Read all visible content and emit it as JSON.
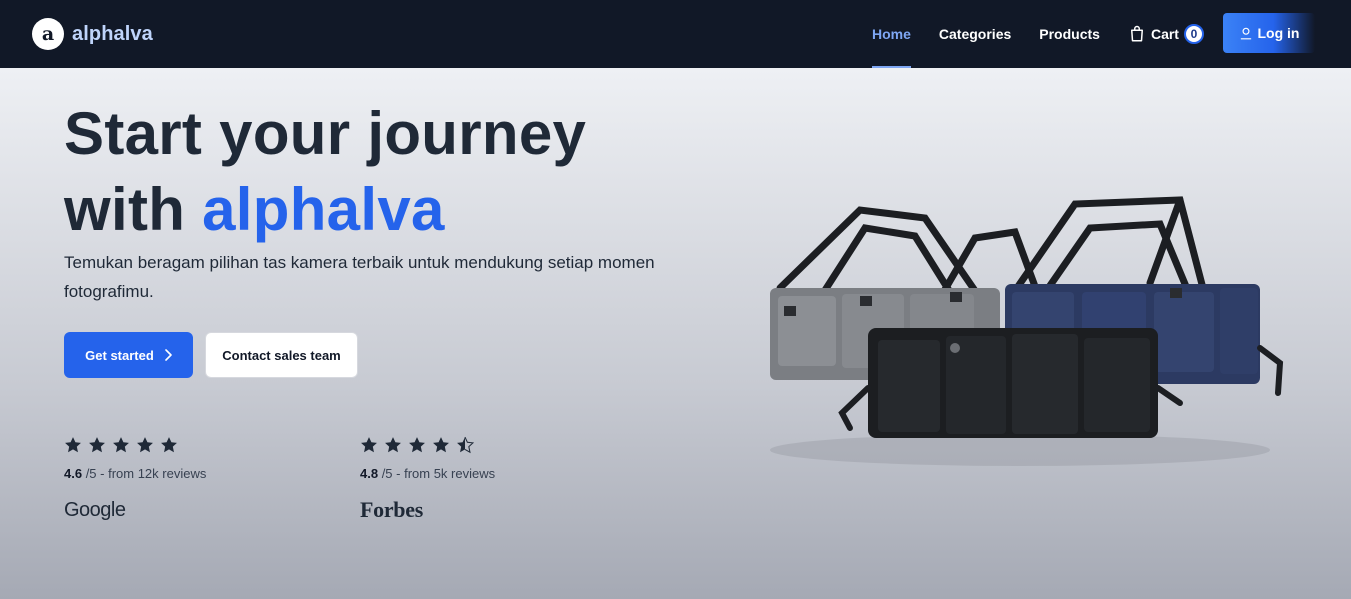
{
  "brand": {
    "logo_glyph": "a",
    "name": "alphalva"
  },
  "nav": {
    "links": [
      "Home",
      "Categories",
      "Products"
    ],
    "active": "Home",
    "cart_label": "Cart",
    "cart_count": "0",
    "login_label": "Log in"
  },
  "hero": {
    "headline_line1": "Start your journey",
    "headline_with": "with ",
    "headline_accent": "alphalva",
    "subtitle": "Temukan beragam pilihan tas kamera terbaik untuk mendukung setiap momen fotografimu.",
    "primary_cta": "Get started",
    "secondary_cta": "Contact sales team"
  },
  "reviews": [
    {
      "stars": 5,
      "score": "4.6",
      "suffix": " /5 - from 12k reviews",
      "source": "Google"
    },
    {
      "stars": 4.5,
      "score": "4.8",
      "suffix": " /5 - from 5k reviews",
      "source": "Forbes"
    }
  ],
  "colors": {
    "nav_bg": "#111827",
    "accent": "#2563eb",
    "active_link": "#7ea6f3",
    "text_dark": "#1f2937"
  },
  "icons": [
    "cart-icon",
    "user-icon",
    "chevron-right-icon",
    "star-icon",
    "half-star-icon"
  ]
}
